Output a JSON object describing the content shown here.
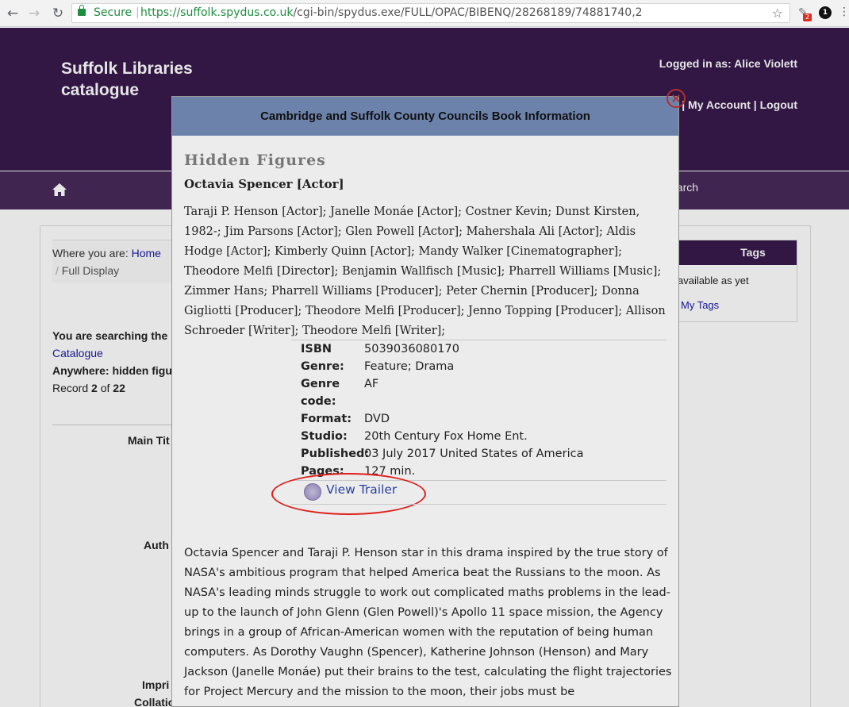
{
  "browser": {
    "secure_label": "Secure",
    "url_host": "https://suffolk.spydus.co.uk",
    "url_path": "/cgi-bin/spydus.exe/FULL/OPAC/BIBENQ/28268189/74881740,2",
    "extension_badge": "2",
    "profile_badge": "1"
  },
  "site": {
    "title": "Suffolk Libraries catalogue",
    "logged_in": "Logged in as: Alice Violett",
    "my_account": "My Account",
    "logout": "Logout",
    "nav_search_fragment": "earch"
  },
  "page": {
    "where_label": "Where you are: ",
    "home_link": "Home",
    "full_display": "Full Display",
    "searching_fragment": "You are searching the l",
    "catalogue_link": "Catalogue",
    "anywhere_fragment": "Anywhere: hidden figu",
    "record_prefix": "Record ",
    "record_num": "2",
    "record_of": " of ",
    "record_total": "22",
    "label_main_title": "Main Tit",
    "label_author": "Auth",
    "label_imprint": "Impri",
    "label_collation": "Collatio",
    "tags_head": "Tags",
    "tags_none": "available as yet",
    "tags_my": "My Tags"
  },
  "dialog": {
    "header": "Cambridge and Suffolk County Councils Book Information",
    "title": "Hidden Figures",
    "author": "Octavia Spencer [Actor]",
    "credits": "Taraji P. Henson [Actor]; Janelle Monáe [Actor]; Costner Kevin; Dunst Kirsten, 1982-; Jim Parsons [Actor]; Glen Powell [Actor]; Mahershala Ali [Actor]; Aldis Hodge [Actor]; Kimberly Quinn [Actor]; Mandy Walker [Cinematographer]; Theodore Melfi [Director]; Benjamin Wallfisch [Music]; Pharrell Williams [Music]; Zimmer Hans; Pharrell Williams [Producer]; Peter Chernin [Producer]; Donna Gigliotti [Producer]; Theodore Melfi [Producer]; Jenno Topping [Producer]; Allison Schroeder [Writer]; Theodore Melfi [Writer];",
    "meta": {
      "isbn_label": "ISBN",
      "isbn": "5039036080170",
      "genre_label": "Genre:",
      "genre": "Feature; Drama",
      "genre_code_label": "Genre code:",
      "genre_code": "AF",
      "format_label": "Format:",
      "format": "DVD",
      "studio_label": "Studio:",
      "studio": "20th Century Fox Home Ent.",
      "published_label": "Published:",
      "published": "03 July 2017 United States of America",
      "pages_label": "Pages:",
      "pages": "127 min."
    },
    "trailer_label": "View Trailer",
    "synopsis": "Octavia Spencer and Taraji P. Henson star in this drama inspired by the true story of NASA's ambitious program that helped America beat the Russians to the moon. As NASA's leading minds struggle to work out complicated maths problems in the lead-up to the launch of John Glenn (Glen Powell)'s Apollo 11 space mission, the Agency brings in a group of African-American women with the reputation of being human computers. As Dorothy Vaughn (Spencer), Katherine Johnson (Henson) and Mary Jackson (Janelle Monáe) put their brains to the test, calculating the flight trajectories for Project Mercury and the mission to the moon, their jobs must be"
  },
  "colors": {
    "header_purple": "#381a4d",
    "nav_purple": "#472a5a",
    "dialog_header": "#6c82ab",
    "annotation_red": "#e0201c"
  }
}
